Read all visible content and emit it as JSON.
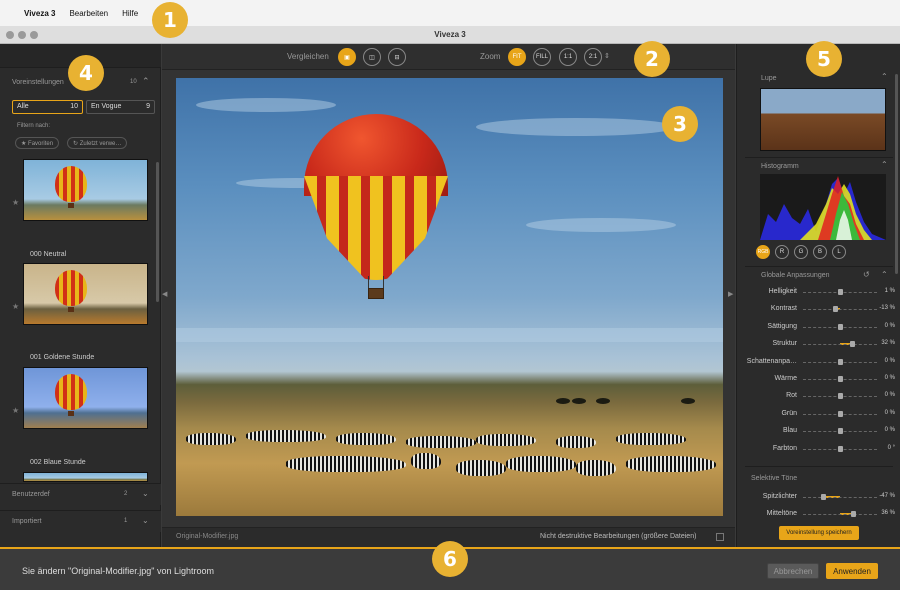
{
  "menubar": {
    "apple": "",
    "app": "Viveza 3",
    "edit": "Bearbeiten",
    "help": "Hilfe"
  },
  "window": {
    "title": "Viveza 3"
  },
  "callouts": [
    "1",
    "2",
    "3",
    "4",
    "5",
    "6"
  ],
  "left_panel": {
    "presets_label": "Voreinstellungen",
    "presets_count": "10",
    "all_label": "Alle",
    "all_count": "10",
    "vogue_label": "En Vogue",
    "vogue_count": "9",
    "filter_label": "Filtern nach:",
    "favorites_chip": "★ Favoriten",
    "recent_chip": "↻ Zuletzt verwe…",
    "thumbnails": [
      {
        "label": "000 Neutral"
      },
      {
        "label": "001 Goldene Stunde"
      },
      {
        "label": "002 Blaue Stunde"
      }
    ],
    "user_section": "Benutzerdef",
    "user_count": "2",
    "imported_section": "Importiert",
    "imported_count": "1"
  },
  "toolbar": {
    "compare_label": "Vergleichen",
    "zoom_label": "Zoom",
    "zoom_fit": "FIT",
    "zoom_fill": "FILL",
    "zoom_11": "1:1",
    "zoom_21": "2:1"
  },
  "center": {
    "filename": "Original-Modifier.jpg",
    "nondestructive": "Nicht destruktive Bearbeitungen (größere Dateien)"
  },
  "right_panel": {
    "loupe_label": "Lupe",
    "histogram_label": "Histogramm",
    "channels": [
      "RGB",
      "R",
      "G",
      "B",
      "L"
    ],
    "global_label": "Globale Anpassungen",
    "adjustments": [
      {
        "name": "Helligkeit",
        "value": "1 %",
        "level": 1
      },
      {
        "name": "Kontrast",
        "value": "-13 %",
        "level": -13
      },
      {
        "name": "Sättigung",
        "value": "0 %",
        "level": 0
      },
      {
        "name": "Struktur",
        "value": "32 %",
        "level": 32
      },
      {
        "name": "Schattenanpa…",
        "value": "0 %",
        "level": 0
      },
      {
        "name": "Wärme",
        "value": "0 %",
        "level": 0
      },
      {
        "name": "Rot",
        "value": "0 %",
        "level": 0
      },
      {
        "name": "Grün",
        "value": "0 %",
        "level": 0
      },
      {
        "name": "Blau",
        "value": "0 %",
        "level": 0
      },
      {
        "name": "Farbton",
        "value": "0 °",
        "level": 0
      }
    ],
    "selective_label": "Selektive Töne",
    "selective": [
      {
        "name": "Spitzlichter",
        "value": "-47 %",
        "level": -47
      },
      {
        "name": "Mitteltöne",
        "value": "36 %",
        "level": 36
      }
    ],
    "save_preset": "Voreinstellung speichern"
  },
  "footer": {
    "message": "Sie ändern \"Original-Modifier.jpg\" von Lightroom",
    "cancel": "Abbrechen",
    "apply": "Anwenden"
  },
  "colors": {
    "accent": "#e8a519",
    "panel": "#2b2b2b",
    "footer": "#3b3b3b"
  }
}
